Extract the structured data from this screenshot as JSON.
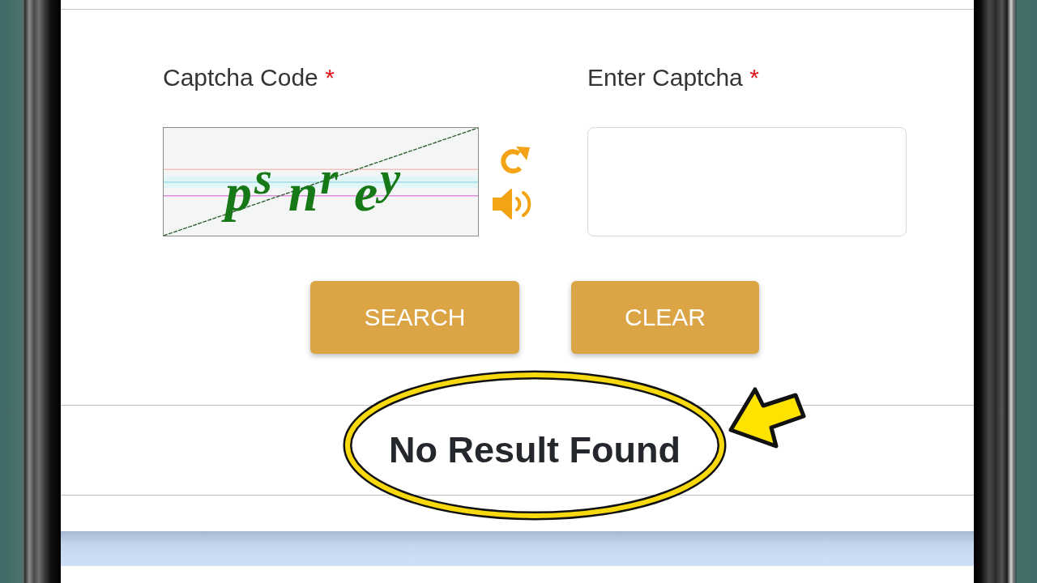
{
  "form": {
    "fields": [
      {
        "kind": "captcha",
        "label": "Captcha Code",
        "required_mark": "*",
        "captcha_text": "p$^{s}$n$^{r}$e$^{y}$"
      },
      {
        "kind": "text_input",
        "label": "Enter Captcha",
        "required_mark": "*"
      }
    ]
  },
  "actions": [
    {
      "label": "SEARCH"
    },
    {
      "label": "CLEAR"
    }
  ],
  "result": {
    "message": "No Result Found",
    "circled": true,
    "arrow": true
  }
}
